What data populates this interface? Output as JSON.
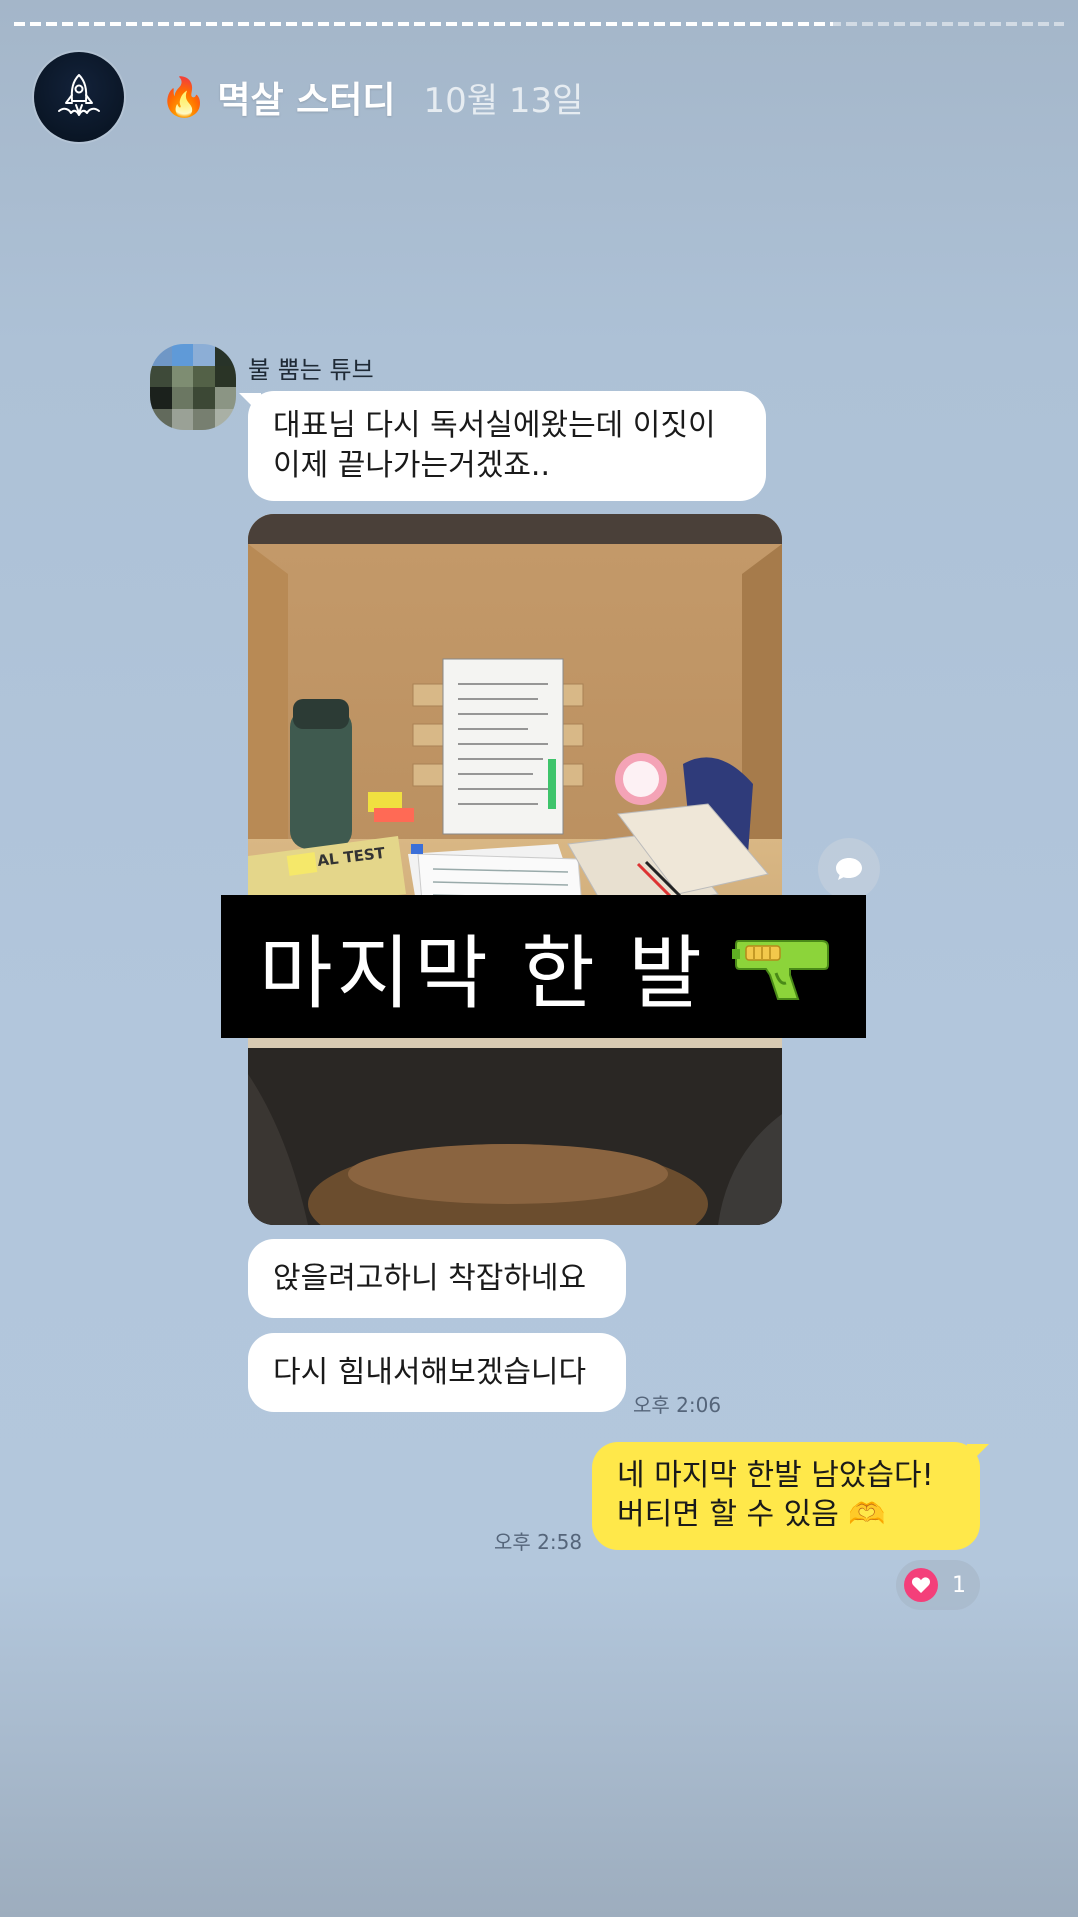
{
  "story": {
    "progress": 0.78
  },
  "header": {
    "title_emoji": "🔥",
    "title": "멱살 스터디",
    "date": "10월 13일"
  },
  "chat": {
    "sender_name": "불 뿜는 튜브",
    "messages": {
      "m1_line1": "대표님 다시 독서실에왔는데 이짓이",
      "m1_line2": "이제 끝나가는거겠죠..",
      "m3": "앉을려고하니 착잡하네요",
      "m4": "다시 힘내서해보겠습니다",
      "m4_time": "오후 2:06",
      "reply_line1": "네 마지막 한발 남았습다!",
      "reply_line2": "버티면 할 수 있음 🫶",
      "reply_time": "오후 2:58",
      "reaction_count": "1"
    },
    "photo_text": {
      "book_title": "AL TEST"
    }
  },
  "sticker": {
    "text": "마지막 한 발"
  },
  "colors": {
    "my_bubble": "#ffe84a",
    "other_bubble": "#ffffff",
    "heart": "#f43f7a"
  },
  "icons": [
    "rocket-icon",
    "fire-icon",
    "comment-icon",
    "heart-icon",
    "water-gun-icon"
  ]
}
